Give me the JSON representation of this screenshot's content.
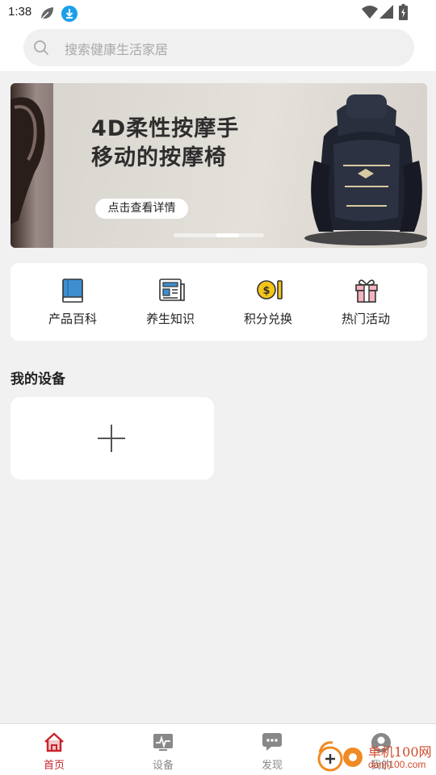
{
  "status_bar": {
    "time": "1:38"
  },
  "search": {
    "placeholder": "搜索健康生活家居"
  },
  "banner": {
    "title_line1": "4D柔性按摩手",
    "title_line2": "移动的按摩椅",
    "button_label": "点击查看详情",
    "slide_count": 5,
    "active_slide": 3
  },
  "quick_menu": [
    {
      "label": "产品百科",
      "icon": "book-icon"
    },
    {
      "label": "养生知识",
      "icon": "newspaper-icon"
    },
    {
      "label": "积分兑换",
      "icon": "coin-exchange-icon"
    },
    {
      "label": "热门活动",
      "icon": "gift-icon"
    }
  ],
  "devices": {
    "title": "我的设备"
  },
  "bottom_nav": [
    {
      "label": "首页",
      "icon": "home-icon",
      "active": true
    },
    {
      "label": "设备",
      "icon": "device-icon",
      "active": false
    },
    {
      "label": "发现",
      "icon": "chat-icon",
      "active": false
    },
    {
      "label": "我的",
      "icon": "profile-icon",
      "active": false
    }
  ],
  "watermark": {
    "line1": "单机100网",
    "line2": "danji100.com"
  },
  "colors": {
    "accent": "#c8232c",
    "background": "#f1f1f1",
    "card": "#ffffff"
  }
}
